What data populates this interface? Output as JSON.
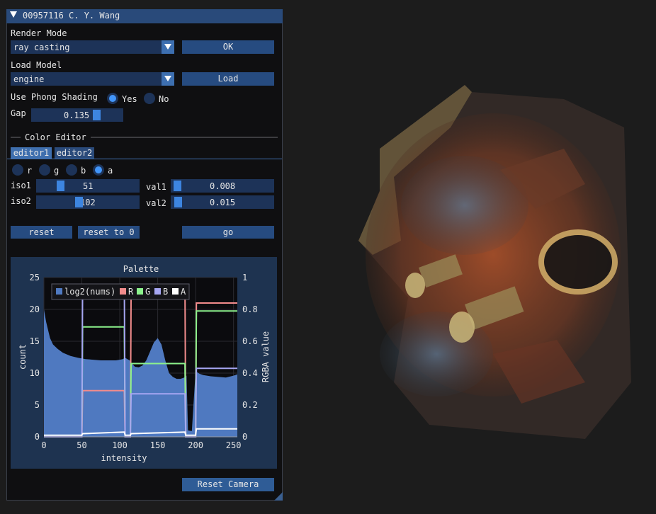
{
  "window": {
    "title": "00957116 C. Y. Wang"
  },
  "render_mode": {
    "label": "Render Mode",
    "value": "ray casting",
    "ok_label": "OK"
  },
  "load_model": {
    "label": "Load Model",
    "value": "engine",
    "load_label": "Load"
  },
  "phong": {
    "label": "Use Phong Shading",
    "yes": "Yes",
    "no": "No",
    "selected": "Yes"
  },
  "gap": {
    "label": "Gap",
    "value": "0.135"
  },
  "color_editor": {
    "header": "Color Editor",
    "tabs": [
      "editor1",
      "editor2"
    ],
    "channels": [
      "r",
      "g",
      "b",
      "a"
    ],
    "selected_channel": "a",
    "iso1": {
      "label": "iso1",
      "value": "51"
    },
    "iso2": {
      "label": "iso2",
      "value": "102"
    },
    "val1": {
      "label": "val1",
      "value": "0.008"
    },
    "val2": {
      "label": "val2",
      "value": "0.015"
    },
    "reset_label": "reset",
    "reset_to_zero_label": "reset to 0",
    "go_label": "go"
  },
  "reset_camera_label": "Reset Camera",
  "chart_data": {
    "type": "area",
    "title": "Palette",
    "xlabel": "intensity",
    "ylabel": "count",
    "y2label": "RGBA value",
    "xlim": [
      0,
      255
    ],
    "ylim": [
      0,
      25
    ],
    "y2lim": [
      0,
      1
    ],
    "xticks": [
      "0",
      "50",
      "100",
      "150",
      "200",
      "250"
    ],
    "yticks": [
      "0",
      "5",
      "10",
      "15",
      "20",
      "25"
    ],
    "y2ticks": [
      "0",
      "0.2",
      "0.4",
      "0.6",
      "0.8",
      "1"
    ],
    "legend_position": "top-left",
    "legend": [
      "log2(nums)",
      "R",
      "G",
      "B",
      "A"
    ],
    "colors": {
      "area": "#4f79c0",
      "R": "#f28c8c",
      "G": "#8cf28c",
      "B": "#a6a6f2",
      "A": "#ffffff"
    },
    "histogram": {
      "x": [
        0,
        3,
        8,
        12,
        18,
        25,
        35,
        45,
        55,
        65,
        75,
        85,
        95,
        100,
        104,
        107,
        110,
        113,
        116,
        120,
        125,
        130,
        135,
        140,
        145,
        150,
        155,
        160,
        165,
        170,
        175,
        180,
        185,
        188,
        190,
        195,
        200,
        205,
        210,
        220,
        230,
        240,
        250,
        255
      ],
      "y": [
        20,
        18,
        15.5,
        14.5,
        13.8,
        13.2,
        12.7,
        12.4,
        12.2,
        12.1,
        12.0,
        12.0,
        12.0,
        12.1,
        12.2,
        12.4,
        12.2,
        12.0,
        11.5,
        11.0,
        10.9,
        11.2,
        12.0,
        13.4,
        14.8,
        15.5,
        14.5,
        12.0,
        10.0,
        9.4,
        9.1,
        9.1,
        9.3,
        9.6,
        1.0,
        0.9,
        10.3,
        9.9,
        9.7,
        9.5,
        9.4,
        9.3,
        9.6,
        9.8
      ]
    },
    "tf": {
      "R": [
        [
          0,
          0
        ],
        [
          50,
          0
        ],
        [
          51,
          0.29
        ],
        [
          106,
          0.29
        ],
        [
          107,
          0
        ],
        [
          114,
          0
        ],
        [
          115,
          0.95
        ],
        [
          186,
          0.95
        ],
        [
          187,
          0
        ],
        [
          200,
          0
        ],
        [
          201,
          0.84
        ],
        [
          255,
          0.84
        ]
      ],
      "G": [
        [
          0,
          0
        ],
        [
          50,
          0
        ],
        [
          51,
          0.69
        ],
        [
          106,
          0.69
        ],
        [
          107,
          0
        ],
        [
          114,
          0
        ],
        [
          115,
          0.46
        ],
        [
          186,
          0.46
        ],
        [
          187,
          0
        ],
        [
          200,
          0
        ],
        [
          201,
          0.79
        ],
        [
          255,
          0.79
        ]
      ],
      "B": [
        [
          0,
          0
        ],
        [
          50,
          0
        ],
        [
          51,
          0.95
        ],
        [
          106,
          0.95
        ],
        [
          107,
          0
        ],
        [
          114,
          0
        ],
        [
          115,
          0.27
        ],
        [
          186,
          0.27
        ],
        [
          187,
          0
        ],
        [
          200,
          0
        ],
        [
          201,
          0.43
        ],
        [
          255,
          0.43
        ]
      ],
      "A": [
        [
          0,
          0.01
        ],
        [
          50,
          0.01
        ],
        [
          51,
          0.02
        ],
        [
          106,
          0.03
        ],
        [
          107,
          0.01
        ],
        [
          114,
          0.01
        ],
        [
          115,
          0.02
        ],
        [
          186,
          0.03
        ],
        [
          187,
          0.01
        ],
        [
          200,
          0.01
        ],
        [
          201,
          0.05
        ],
        [
          255,
          0.05
        ]
      ]
    }
  }
}
